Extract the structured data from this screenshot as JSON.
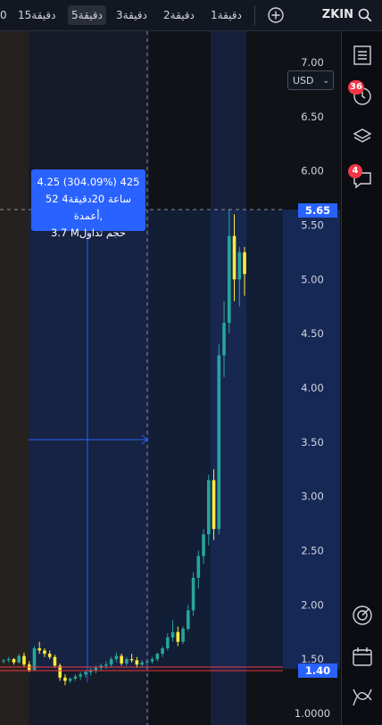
{
  "header": {
    "timeframes": [
      {
        "label": "1دقيقة"
      },
      {
        "label": "2دقيقة"
      },
      {
        "label": "3دقيقة"
      },
      {
        "label": "5دقيقة"
      },
      {
        "label": "15دقيقة"
      },
      {
        "label": "0"
      }
    ],
    "active_timeframe": "5دقيقة",
    "symbol": "ZKIN"
  },
  "chart": {
    "currency_selector": "USD",
    "measure_tooltip": {
      "line1": "4.25 (304.09%) 425",
      "line2": "52 ساعة 20دقيقة4 ,أعمدة",
      "line3": "3.7 Mحجم تداول"
    },
    "crosshair_price": "5.65",
    "last_price": "1.40"
  },
  "chart_data": {
    "type": "candlestick",
    "y_axis_ticks": [
      "7.00",
      "6.50",
      "6.00",
      "5.50",
      "5.00",
      "4.50",
      "4.00",
      "3.50",
      "3.00",
      "2.50",
      "2.00",
      "1.50",
      "1.0000"
    ],
    "ylim": [
      0.85,
      7.05
    ],
    "candles": [
      [
        1.48,
        1.5,
        1.46,
        1.49
      ],
      [
        1.49,
        1.52,
        1.47,
        1.5
      ],
      [
        1.5,
        1.51,
        1.45,
        1.47
      ],
      [
        1.47,
        1.55,
        1.46,
        1.53
      ],
      [
        1.53,
        1.56,
        1.43,
        1.45
      ],
      [
        1.45,
        1.48,
        1.38,
        1.4
      ],
      [
        1.4,
        1.62,
        1.39,
        1.6
      ],
      [
        1.6,
        1.66,
        1.55,
        1.58
      ],
      [
        1.58,
        1.6,
        1.52,
        1.55
      ],
      [
        1.55,
        1.58,
        1.5,
        1.52
      ],
      [
        1.52,
        1.54,
        1.42,
        1.44
      ],
      [
        1.44,
        1.46,
        1.3,
        1.33
      ],
      [
        1.33,
        1.36,
        1.26,
        1.3
      ],
      [
        1.3,
        1.33,
        1.28,
        1.32
      ],
      [
        1.32,
        1.36,
        1.3,
        1.34
      ],
      [
        1.34,
        1.38,
        1.31,
        1.36
      ],
      [
        1.36,
        1.4,
        1.33,
        1.38
      ],
      [
        1.38,
        1.42,
        1.35,
        1.4
      ],
      [
        1.4,
        1.44,
        1.37,
        1.42
      ],
      [
        1.42,
        1.46,
        1.39,
        1.44
      ],
      [
        1.44,
        1.48,
        1.41,
        1.45
      ],
      [
        1.45,
        1.52,
        1.43,
        1.5
      ],
      [
        1.5,
        1.56,
        1.47,
        1.53
      ],
      [
        1.53,
        1.55,
        1.44,
        1.46
      ],
      [
        1.46,
        1.52,
        1.44,
        1.5
      ],
      [
        1.5,
        1.55,
        1.47,
        1.49
      ],
      [
        1.49,
        1.52,
        1.42,
        1.45
      ],
      [
        1.45,
        1.49,
        1.43,
        1.47
      ],
      [
        1.47,
        1.5,
        1.44,
        1.48
      ],
      [
        1.48,
        1.52,
        1.46,
        1.5
      ],
      [
        1.5,
        1.56,
        1.48,
        1.55
      ],
      [
        1.55,
        1.62,
        1.52,
        1.6
      ],
      [
        1.6,
        1.74,
        1.58,
        1.7
      ],
      [
        1.7,
        1.86,
        1.66,
        1.75
      ],
      [
        1.75,
        1.8,
        1.62,
        1.66
      ],
      [
        1.66,
        1.8,
        1.64,
        1.78
      ],
      [
        1.78,
        2.0,
        1.76,
        1.95
      ],
      [
        1.95,
        2.3,
        1.9,
        2.25
      ],
      [
        2.25,
        2.5,
        2.15,
        2.45
      ],
      [
        2.45,
        2.7,
        2.38,
        2.65
      ],
      [
        2.65,
        3.2,
        2.55,
        3.15
      ],
      [
        3.15,
        3.25,
        2.6,
        2.7
      ],
      [
        2.7,
        4.4,
        2.65,
        4.3
      ],
      [
        4.3,
        4.8,
        4.1,
        4.6
      ],
      [
        4.6,
        5.65,
        4.5,
        5.4
      ],
      [
        5.4,
        5.6,
        4.8,
        5.0
      ],
      [
        5.0,
        5.3,
        4.75,
        5.25
      ],
      [
        5.25,
        5.3,
        4.85,
        5.05
      ]
    ]
  },
  "sidebar": {
    "alerts_count": "36",
    "chat_count": "4"
  },
  "colors": {
    "up": "#26a69a",
    "down": "#ffeb3b",
    "accent": "#2962ff",
    "last_price": "#2962ff",
    "price_line": "#f23645"
  }
}
